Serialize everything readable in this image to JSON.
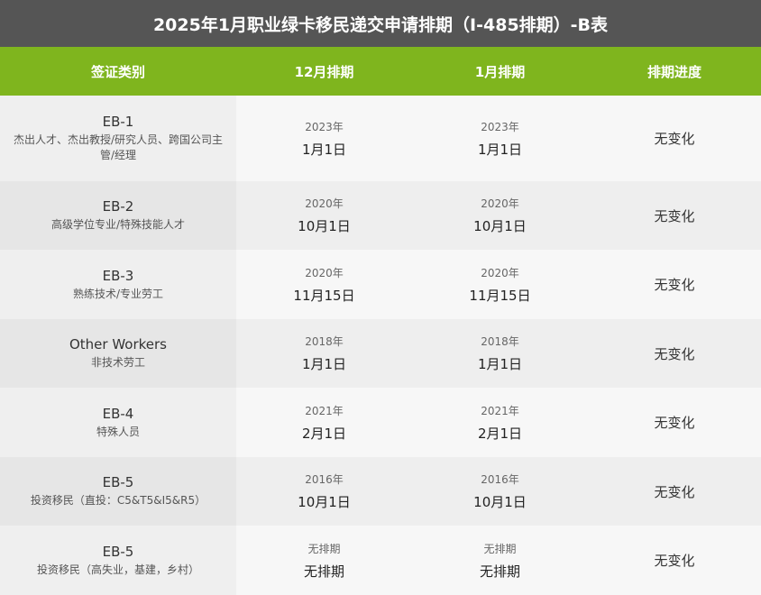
{
  "title": "2025年1月职业绿卡移民递交申请排期（I-485排期）-B表",
  "columns": [
    "签证类别",
    "12月排期",
    "1月排期",
    "排期进度"
  ],
  "rows": [
    {
      "code": "EB-1",
      "desc": "杰出人才、杰出教授/研究人员、跨国公司主管/经理",
      "dec_year": "2023年",
      "dec_date": "1月1日",
      "jan_year": "2023年",
      "jan_date": "1月1日",
      "progress": "无变化"
    },
    {
      "code": "EB-2",
      "desc": "高级学位专业/特殊技能人才",
      "dec_year": "2020年",
      "dec_date": "10月1日",
      "jan_year": "2020年",
      "jan_date": "10月1日",
      "progress": "无变化"
    },
    {
      "code": "EB-3",
      "desc": "熟练技术/专业劳工",
      "dec_year": "2020年",
      "dec_date": "11月15日",
      "jan_year": "2020年",
      "jan_date": "11月15日",
      "progress": "无变化"
    },
    {
      "code": "Other Workers",
      "desc": "非技术劳工",
      "dec_year": "2018年",
      "dec_date": "1月1日",
      "jan_year": "2018年",
      "jan_date": "1月1日",
      "progress": "无变化"
    },
    {
      "code": "EB-4",
      "desc": "特殊人员",
      "dec_year": "2021年",
      "dec_date": "2月1日",
      "jan_year": "2021年",
      "jan_date": "2月1日",
      "progress": "无变化"
    },
    {
      "code": "EB-5",
      "desc": "投资移民（直投：C5&T5&I5&R5）",
      "dec_year": "2016年",
      "dec_date": "10月1日",
      "jan_year": "2016年",
      "jan_date": "10月1日",
      "progress": "无变化"
    },
    {
      "code": "EB-5",
      "desc": "投资移民（高失业，基建，乡村）",
      "dec_year": "无排期",
      "dec_date": "无排期",
      "jan_year": "无排期",
      "jan_date": "无排期",
      "progress": "无变化"
    }
  ]
}
